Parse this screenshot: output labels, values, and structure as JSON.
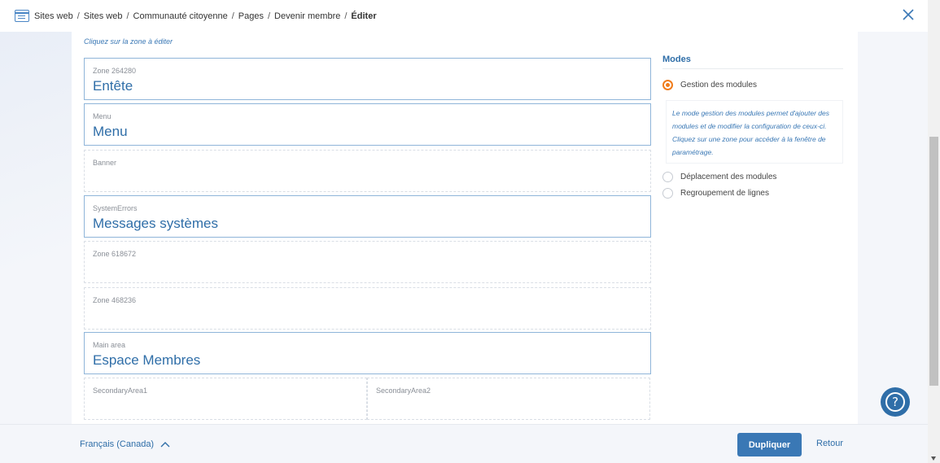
{
  "breadcrumb": [
    "Sites web",
    "Sites web",
    "Communauté citoyenne",
    "Pages",
    "Devenir membre",
    "Éditer"
  ],
  "hint": "Cliquez sur la zone à éditer",
  "zones": [
    {
      "label": "Zone 264280",
      "title": "Entête"
    },
    {
      "label": "Menu",
      "title": "Menu"
    },
    {
      "label": "Banner",
      "title": ""
    },
    {
      "label": "SystemErrors",
      "title": "Messages systèmes"
    },
    {
      "label": "Zone 618672",
      "title": ""
    },
    {
      "label": "Zone 468236",
      "title": ""
    },
    {
      "label": "Main area",
      "title": "Espace Membres"
    }
  ],
  "secondary": [
    "SecondaryArea1",
    "SecondaryArea2"
  ],
  "modes": {
    "title": "Modes",
    "options": [
      "Gestion des modules",
      "Déplacement des modules",
      "Regroupement de lignes"
    ],
    "selected": "Gestion des modules",
    "description": "Le mode gestion des modules permet d'ajouter des modules et de modifier la configuration de ceux-ci. Cliquez sur une zone pour accéder à la fenêtre de paramétrage."
  },
  "footer": {
    "language": "Français (Canada)",
    "duplicate": "Dupliquer",
    "back": "Retour"
  },
  "help": "?",
  "colors": {
    "accent": "#2f6ea8",
    "button": "#3a78b5",
    "radio_selected": "#f07c1c"
  }
}
